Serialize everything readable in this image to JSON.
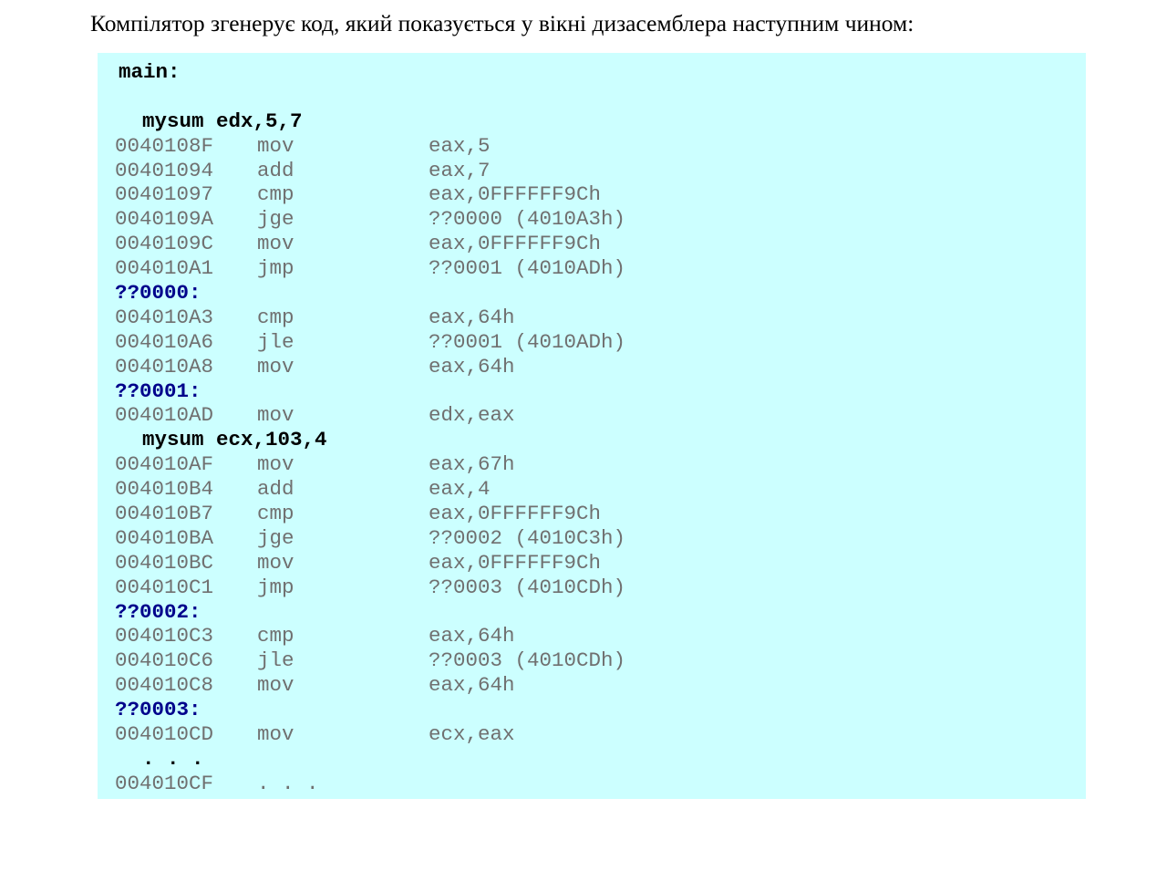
{
  "intro_text": "Компілятор згенерує код, який показується у вікні дизасемблера наступним чином:",
  "listing": [
    {
      "kind": "src",
      "indent": 1,
      "text": "main:"
    },
    {
      "kind": "blank"
    },
    {
      "kind": "src",
      "indent": 2,
      "text": "mysum edx,5,7"
    },
    {
      "kind": "asm",
      "addr": "0040108F",
      "op": "mov",
      "args": "eax,5"
    },
    {
      "kind": "asm",
      "addr": "00401094",
      "op": "add",
      "args": "eax,7"
    },
    {
      "kind": "asm",
      "addr": "00401097",
      "op": "cmp",
      "args": "eax,0FFFFFF9Ch"
    },
    {
      "kind": "asm",
      "addr": "0040109A",
      "op": "jge",
      "args": "??0000 (4010A3h)"
    },
    {
      "kind": "asm",
      "addr": "0040109C",
      "op": "mov",
      "args": "eax,0FFFFFF9Ch"
    },
    {
      "kind": "asm",
      "addr": "004010A1",
      "op": "jmp",
      "args": "??0001 (4010ADh)"
    },
    {
      "kind": "label",
      "text": "??0000:"
    },
    {
      "kind": "asm",
      "addr": "004010A3",
      "op": "cmp",
      "args": "eax,64h"
    },
    {
      "kind": "asm",
      "addr": "004010A6",
      "op": "jle",
      "args": "??0001 (4010ADh)"
    },
    {
      "kind": "asm",
      "addr": "004010A8",
      "op": "mov",
      "args": "eax,64h"
    },
    {
      "kind": "label",
      "text": "??0001:"
    },
    {
      "kind": "asm",
      "addr": "004010AD",
      "op": "mov",
      "args": "edx,eax"
    },
    {
      "kind": "src",
      "indent": 2,
      "text": "mysum ecx,103,4"
    },
    {
      "kind": "asm",
      "addr": "004010AF",
      "op": "mov",
      "args": "eax,67h"
    },
    {
      "kind": "asm",
      "addr": "004010B4",
      "op": "add",
      "args": "eax,4"
    },
    {
      "kind": "asm",
      "addr": "004010B7",
      "op": "cmp",
      "args": "eax,0FFFFFF9Ch"
    },
    {
      "kind": "asm",
      "addr": "004010BA",
      "op": "jge",
      "args": "??0002 (4010C3h)"
    },
    {
      "kind": "asm",
      "addr": "004010BC",
      "op": "mov",
      "args": "eax,0FFFFFF9Ch"
    },
    {
      "kind": "asm",
      "addr": "004010C1",
      "op": "jmp",
      "args": "??0003 (4010CDh)"
    },
    {
      "kind": "label",
      "text": "??0002:"
    },
    {
      "kind": "asm",
      "addr": "004010C3",
      "op": "cmp",
      "args": "eax,64h"
    },
    {
      "kind": "asm",
      "addr": "004010C6",
      "op": "jle",
      "args": "??0003 (4010CDh)"
    },
    {
      "kind": "asm",
      "addr": "004010C8",
      "op": "mov",
      "args": "eax,64h"
    },
    {
      "kind": "label",
      "text": "??0003:"
    },
    {
      "kind": "asm",
      "addr": "004010CD",
      "op": "mov",
      "args": "ecx,eax"
    },
    {
      "kind": "src",
      "indent": 2,
      "text": ". . ."
    },
    {
      "kind": "asm",
      "addr": "004010CF",
      "op": ". . .",
      "args": ""
    }
  ]
}
